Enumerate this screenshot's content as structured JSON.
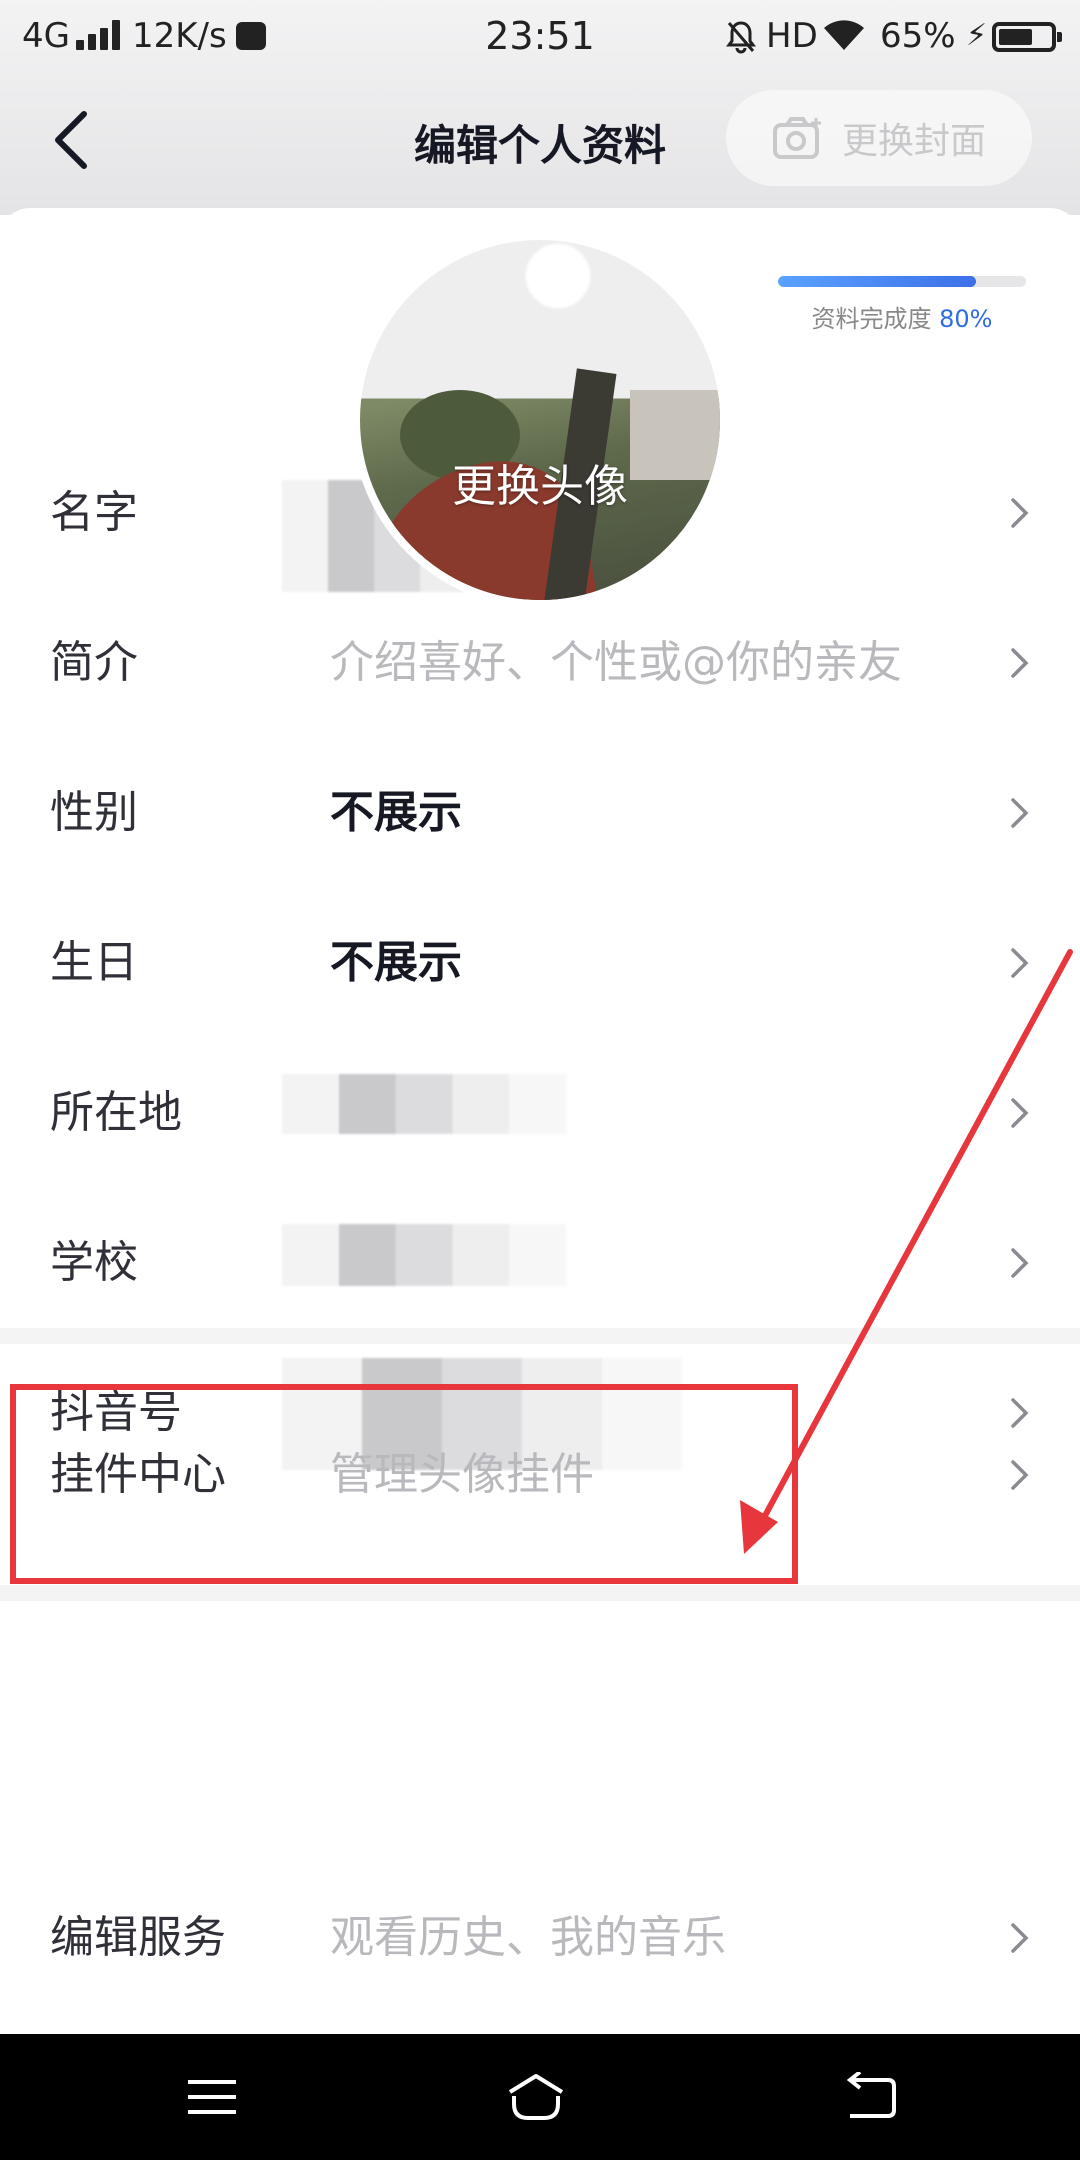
{
  "status_bar": {
    "network": "4G",
    "speed": "12K/s",
    "time": "23:51",
    "hd": "HD",
    "battery_percent": "65%",
    "battery_level": 0.65
  },
  "header": {
    "title": "编辑个人资料",
    "change_cover_label": "更换封面"
  },
  "avatar": {
    "label": "更换头像"
  },
  "completeness": {
    "label": "资料完成度",
    "value_text": "80%",
    "value": 0.8,
    "bar_colors": [
      "#5aa2ff",
      "#3d6fe8"
    ]
  },
  "profile_rows": [
    {
      "label": "名字",
      "value": ""
    },
    {
      "label": "简介",
      "value": "介绍喜好、个性或@你的亲友"
    },
    {
      "label": "性别",
      "value": "不展示"
    },
    {
      "label": "生日",
      "value": "不展示"
    },
    {
      "label": "所在地",
      "value": ""
    },
    {
      "label": "学校",
      "value": ""
    },
    {
      "label": "抖音号",
      "value": ""
    }
  ],
  "pendant_row": {
    "label": "挂件中心",
    "value": "管理头像挂件"
  },
  "service_row": {
    "label": "编辑服务",
    "value": "观看历史、我的音乐"
  },
  "annotation": {
    "color": "#e7373c"
  }
}
